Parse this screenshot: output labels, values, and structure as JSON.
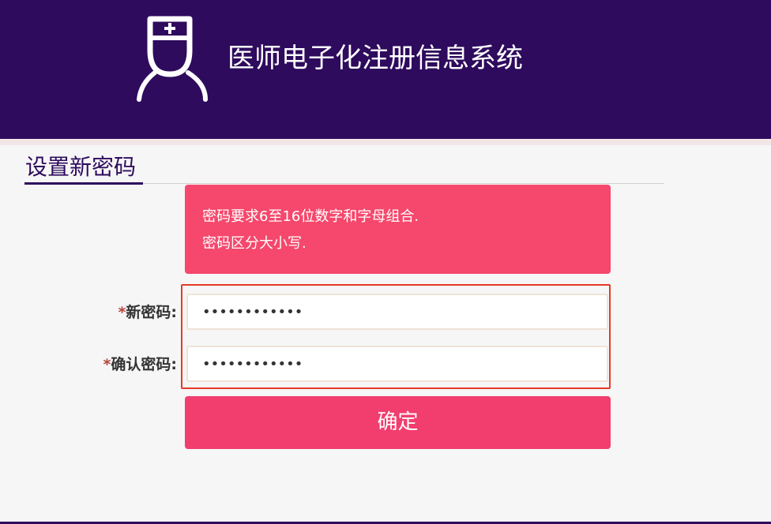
{
  "header": {
    "app_title": "医师电子化注册信息系统",
    "logo_icon": "doctor-nurse-icon"
  },
  "page": {
    "heading": "设置新密码"
  },
  "alert": {
    "lines": [
      "密码要求6至16位数字和字母组合.",
      "密码区分大小写."
    ]
  },
  "form": {
    "required_mark": "*",
    "new_password": {
      "label": "新密码:",
      "value": "••••••••••••"
    },
    "confirm_password": {
      "label": "确认密码:",
      "value": "••••••••••••"
    },
    "submit_label": "确定"
  },
  "colors": {
    "header_bg": "#2e0b5d",
    "accent": "#f13e6e",
    "alert_bg": "#f5486c",
    "highlight_border": "#e53a28"
  }
}
